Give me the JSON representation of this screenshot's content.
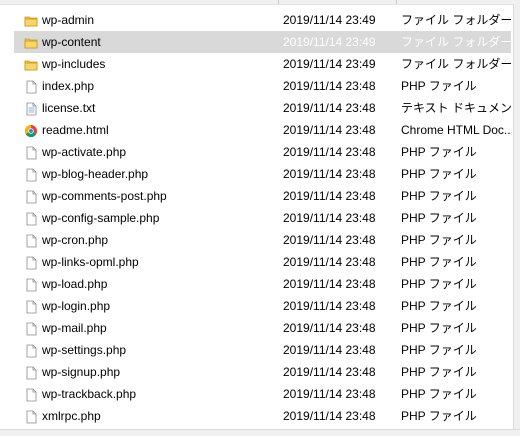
{
  "files": [
    {
      "name": "wp-admin",
      "date": "2019/11/14 23:49",
      "type": "ファイル フォルダー",
      "icon": "folder-icon"
    },
    {
      "name": "wp-content",
      "date": "2019/11/14 23:49",
      "type": "ファイル フォルダー",
      "icon": "folder-icon",
      "selected": true
    },
    {
      "name": "wp-includes",
      "date": "2019/11/14 23:49",
      "type": "ファイル フォルダー",
      "icon": "folder-icon"
    },
    {
      "name": "index.php",
      "date": "2019/11/14 23:48",
      "type": "PHP ファイル",
      "icon": "file-icon"
    },
    {
      "name": "license.txt",
      "date": "2019/11/14 23:48",
      "type": "テキスト ドキュメント",
      "icon": "text-file-icon"
    },
    {
      "name": "readme.html",
      "date": "2019/11/14 23:48",
      "type": "Chrome HTML Doc...",
      "icon": "chrome-icon"
    },
    {
      "name": "wp-activate.php",
      "date": "2019/11/14 23:48",
      "type": "PHP ファイル",
      "icon": "file-icon"
    },
    {
      "name": "wp-blog-header.php",
      "date": "2019/11/14 23:48",
      "type": "PHP ファイル",
      "icon": "file-icon"
    },
    {
      "name": "wp-comments-post.php",
      "date": "2019/11/14 23:48",
      "type": "PHP ファイル",
      "icon": "file-icon"
    },
    {
      "name": "wp-config-sample.php",
      "date": "2019/11/14 23:48",
      "type": "PHP ファイル",
      "icon": "file-icon"
    },
    {
      "name": "wp-cron.php",
      "date": "2019/11/14 23:48",
      "type": "PHP ファイル",
      "icon": "file-icon"
    },
    {
      "name": "wp-links-opml.php",
      "date": "2019/11/14 23:48",
      "type": "PHP ファイル",
      "icon": "file-icon"
    },
    {
      "name": "wp-load.php",
      "date": "2019/11/14 23:48",
      "type": "PHP ファイル",
      "icon": "file-icon"
    },
    {
      "name": "wp-login.php",
      "date": "2019/11/14 23:48",
      "type": "PHP ファイル",
      "icon": "file-icon"
    },
    {
      "name": "wp-mail.php",
      "date": "2019/11/14 23:48",
      "type": "PHP ファイル",
      "icon": "file-icon"
    },
    {
      "name": "wp-settings.php",
      "date": "2019/11/14 23:48",
      "type": "PHP ファイル",
      "icon": "file-icon"
    },
    {
      "name": "wp-signup.php",
      "date": "2019/11/14 23:48",
      "type": "PHP ファイル",
      "icon": "file-icon"
    },
    {
      "name": "wp-trackback.php",
      "date": "2019/11/14 23:48",
      "type": "PHP ファイル",
      "icon": "file-icon"
    },
    {
      "name": "xmlrpc.php",
      "date": "2019/11/14 23:48",
      "type": "PHP ファイル",
      "icon": "file-icon"
    }
  ],
  "colors": {
    "folder": "#f5c542",
    "selected_bg": "#d9d9d9"
  }
}
